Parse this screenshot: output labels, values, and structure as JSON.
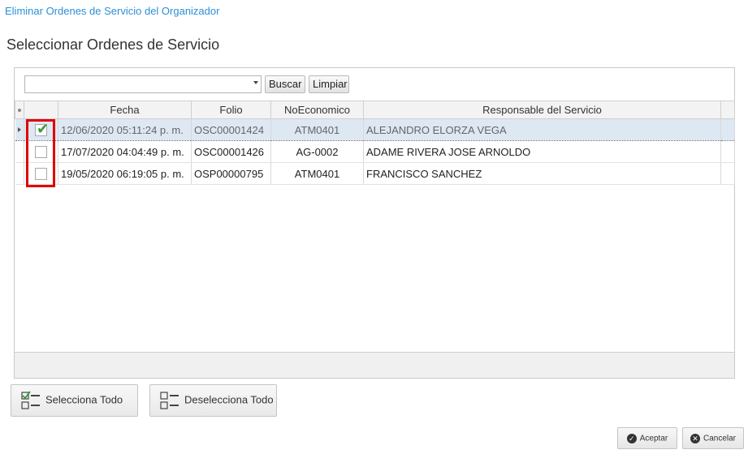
{
  "window": {
    "title": "Eliminar Ordenes de Servicio del Organizador"
  },
  "page": {
    "title": "Seleccionar Ordenes de Servicio"
  },
  "toolbar": {
    "search_value": "",
    "buscar_label": "Buscar",
    "limpiar_label": "Limpiar"
  },
  "grid": {
    "columns": [
      "Fecha",
      "Folio",
      "NoEconomico",
      "Responsable del Servicio"
    ],
    "rows": [
      {
        "checked": true,
        "fecha": "12/06/2020 05:11:24 p. m.",
        "folio": "OSC00001424",
        "noeconomico": "ATM0401",
        "responsable": "ALEJANDRO ELORZA VEGA"
      },
      {
        "checked": false,
        "fecha": "17/07/2020 04:04:49 p. m.",
        "folio": "OSC00001426",
        "noeconomico": "AG-0002",
        "responsable": "ADAME RIVERA JOSE ARNOLDO"
      },
      {
        "checked": false,
        "fecha": "19/05/2020 06:19:05 p. m.",
        "folio": "OSP00000795",
        "noeconomico": "ATM0401",
        "responsable": "FRANCISCO SANCHEZ"
      }
    ]
  },
  "buttons": {
    "select_all": "Selecciona Todo",
    "deselect_all": "Deselecciona Todo",
    "accept": "Aceptar",
    "cancel": "Cancelar"
  },
  "colors": {
    "title_blue": "#2b8fd6",
    "selected_row": "#dde8f3",
    "highlight_red": "#e00000",
    "check_green": "#3a9a3a"
  }
}
